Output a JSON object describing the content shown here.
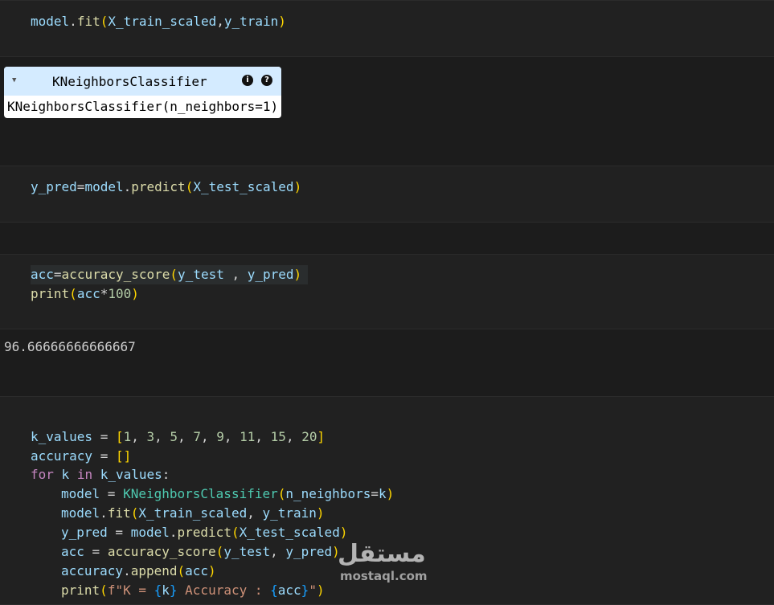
{
  "cells": {
    "fit": {
      "tokens": [
        "model",
        ".",
        "fit",
        "(",
        "X_train_scaled",
        ",",
        "y_train",
        ")"
      ]
    },
    "widget": {
      "header_title": "KNeighborsClassifier",
      "toggle_icon": "triangle-down-icon",
      "info_glyph": "i",
      "help_glyph": "?",
      "repr": "KNeighborsClassifier(n_neighbors=1)"
    },
    "predict": {
      "tokens": [
        "y_pred",
        "=",
        "model",
        ".",
        "predict",
        "(",
        "X_test_scaled",
        ")"
      ]
    },
    "accuracy": {
      "line1": [
        "acc",
        "=",
        "accuracy_score",
        "(",
        "y_test",
        " , ",
        "y_pred",
        ")"
      ],
      "line2": [
        "print",
        "(",
        "acc",
        "*",
        "100",
        ")"
      ]
    },
    "accuracy_output": "96.66666666666667",
    "loop": {
      "l1": [
        "k_values",
        " = ",
        "[",
        "1",
        ", ",
        "3",
        ", ",
        "5",
        ", ",
        "7",
        ", ",
        "9",
        ", ",
        "11",
        ", ",
        "15",
        ", ",
        "20",
        "]"
      ],
      "l2": [
        "accuracy",
        " = ",
        "[]"
      ],
      "l3": [
        "for",
        " ",
        "k",
        " ",
        "in",
        " ",
        "k_values",
        ":"
      ],
      "l4": [
        "model",
        " = ",
        "KNeighborsClassifier",
        "(",
        "n_neighbors",
        "=",
        "k",
        ")"
      ],
      "l5": [
        "model",
        ".",
        "fit",
        "(",
        "X_train_scaled",
        ", ",
        "y_train",
        ")"
      ],
      "l6": [
        "y_pred",
        " = ",
        "model",
        ".",
        "predict",
        "(",
        "X_test_scaled",
        ")"
      ],
      "l7": [
        "acc",
        " = ",
        "accuracy_score",
        "(",
        "y_test",
        ", ",
        "y_pred",
        ")"
      ],
      "l8": [
        "accuracy",
        ".",
        "append",
        "(",
        "acc",
        ")"
      ],
      "l9": [
        "print",
        "(",
        "f\"K = ",
        "{",
        "k",
        "}",
        " Accuracy : ",
        "{",
        "acc",
        "}",
        "\"",
        ")"
      ]
    }
  },
  "watermark": {
    "arabic": "مستقل",
    "latin": "mostaql.com"
  },
  "colors": {
    "background": "#1f1f1f",
    "variable": "#9cdcfe",
    "function": "#dcdcaa",
    "class": "#4ec9b0",
    "number": "#b5cea8",
    "keyword": "#c586c0",
    "string": "#ce9178",
    "bracket_level1": "#ffd700",
    "widget_header": "#d4ebff"
  }
}
